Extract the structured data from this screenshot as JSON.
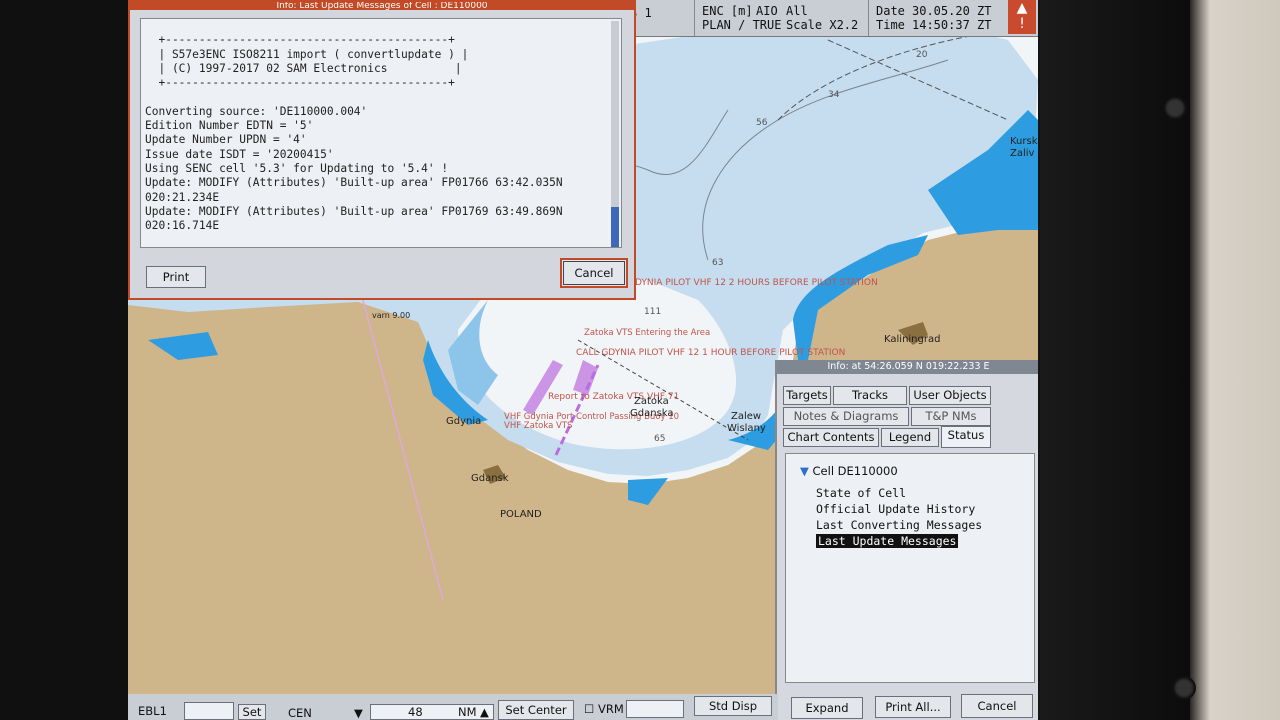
{
  "topbar": {
    "mode_fragment": "S 1",
    "enc_label": "ENC [m]",
    "aio_label": "AIO",
    "all_label": "All",
    "plan_label": "PLAN / TRUE",
    "scale_label": "Scale X2.2",
    "date_label": "Date",
    "time_label": "Time",
    "date_value": "30.05.20 ZT",
    "time_value": "14:50:37 ZT"
  },
  "dialog": {
    "title": "Info: Last Update Messages of Cell : DE110000",
    "lines": [
      "",
      "  +------------------------------------------+",
      "  | S57e3ENC ISO8211 import ( convertlupdate ) |",
      "  | (C) 1997-2017 02 SAM Electronics          |",
      "  +------------------------------------------+",
      "",
      "Converting source: 'DE110000.004'",
      "Edition Number EDTN = '5'",
      "Update Number UPDN = '4'",
      "Issue date ISDT = '20200415'",
      "Using SENC cell '5.3' for Updating to '5.4' !",
      "Update: MODIFY (Attributes) 'Built-up area' FP01766 63:42.035N",
      "020:21.234E",
      "Update: MODIFY (Attributes) 'Built-up area' FP01769 63:49.869N",
      "020:16.714E"
    ],
    "print_label": "Print",
    "cancel_label": "Cancel"
  },
  "map_labels": {
    "l1": "GDYNIA PILOT VHF 12 2 HOURS BEFORE PILOT STATION",
    "l2": "CALL GDYNIA PILOT VHF 12 1 HOUR BEFORE PILOT STATION",
    "l3": "Zatoka VTS Entering the Area",
    "l4": "Report to Zatoka VTS VHF 71",
    "l5": "VHF Gdynia Port Control Passing Buoy 10",
    "l6": "VHF Zatoka VTS",
    "gdynia": "Gdynia",
    "gdansk": "Gdansk",
    "zatoka": "Zatoka",
    "gdanska": "Gdanska",
    "zalew": "Zalew",
    "wislany": "Wislany",
    "poland": "POLAND",
    "kaliningrad": "Kaliningrad",
    "kursk": "Kursk",
    "zaliv": "Zaliv",
    "varn": "varn 9.00",
    "d20": "20",
    "d34": "34",
    "d56": "56",
    "d63": "63",
    "d111": "111",
    "d65": "65"
  },
  "panel": {
    "title": "Info: at 54:26.059 N  019:22.233 E",
    "tabs": {
      "targets": "Targets",
      "tracks": "Tracks",
      "user_objects": "User Objects",
      "notes": "Notes & Diagrams",
      "tp_nms": "T&P NMs",
      "chart_contents": "Chart Contents",
      "legend": "Legend",
      "status": "Status"
    },
    "tree_root": "Cell DE110000",
    "tree_items": [
      "State of Cell",
      "Official Update History",
      "Last Converting Messages",
      "Last Update Messages"
    ],
    "expand_label": "Expand",
    "print_all_label": "Print All...",
    "cancel_label": "Cancel"
  },
  "bottombar": {
    "ebl_label": "EBL1",
    "set_label": "Set",
    "cen_label": "CEN",
    "range_value": "48",
    "range_unit": "NM",
    "set_center_label": "Set Center",
    "vrm_label": "VRM",
    "std_disp_label": "Std Disp"
  },
  "colors": {
    "land": "#cfb58a",
    "deep_water": "#f2f5f8",
    "mid_water": "#c5ddef",
    "shallow_water": "#8cc4ea",
    "coast_water": "#2d9ce0",
    "chart_text": "#c0544a",
    "accent": "#c24a26"
  }
}
